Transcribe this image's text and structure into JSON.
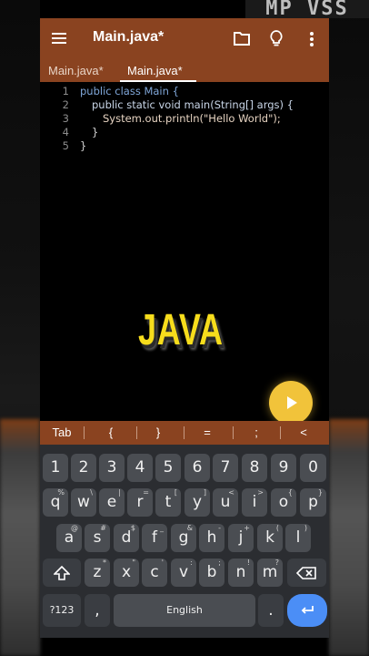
{
  "overlay": {
    "watermark": "MP VSS",
    "paren": ")",
    "caption": "JAVA"
  },
  "app": {
    "title": "Main.java*",
    "icons": [
      "menu-icon",
      "folder-icon",
      "lightbulb-icon",
      "more-vert-icon"
    ],
    "accent": "#8a4320"
  },
  "tabs": [
    {
      "label": "Main.java*",
      "active": false
    },
    {
      "label": "Main.java*",
      "active": true
    }
  ],
  "editor": {
    "lines": [
      {
        "n": "1",
        "text": "public class Main {"
      },
      {
        "n": "2",
        "text": "public static void main(String[] args) {"
      },
      {
        "n": "3",
        "text": "System.out.println(\"Hello World\");"
      },
      {
        "n": "4",
        "text": "}"
      },
      {
        "n": "5",
        "text": "}"
      }
    ]
  },
  "run_button": {
    "icon": "play-icon",
    "color": "#f1c33a"
  },
  "symbols": [
    "Tab",
    "{",
    "}",
    "=",
    ";",
    "<"
  ],
  "keyboard": {
    "row_numbers": [
      "1",
      "2",
      "3",
      "4",
      "5",
      "6",
      "7",
      "8",
      "9",
      "0"
    ],
    "row1": [
      {
        "k": "q",
        "s": "%"
      },
      {
        "k": "w",
        "s": "\\"
      },
      {
        "k": "e",
        "s": "|"
      },
      {
        "k": "r",
        "s": "="
      },
      {
        "k": "t",
        "s": "["
      },
      {
        "k": "y",
        "s": "]"
      },
      {
        "k": "u",
        "s": "<"
      },
      {
        "k": "i",
        "s": ">"
      },
      {
        "k": "o",
        "s": "{"
      },
      {
        "k": "p",
        "s": "}"
      }
    ],
    "row2": [
      {
        "k": "a",
        "s": "@"
      },
      {
        "k": "s",
        "s": "#"
      },
      {
        "k": "d",
        "s": "$"
      },
      {
        "k": "f",
        "s": "_"
      },
      {
        "k": "g",
        "s": "&"
      },
      {
        "k": "h",
        "s": "-"
      },
      {
        "k": "j",
        "s": "+"
      },
      {
        "k": "k",
        "s": "("
      },
      {
        "k": "l",
        "s": ")"
      }
    ],
    "row3": [
      {
        "k": "z",
        "s": "*"
      },
      {
        "k": "x",
        "s": "\""
      },
      {
        "k": "c",
        "s": "'"
      },
      {
        "k": "v",
        "s": ":"
      },
      {
        "k": "b",
        "s": ";"
      },
      {
        "k": "n",
        "s": "!"
      },
      {
        "k": "m",
        "s": "?"
      }
    ],
    "symbols_key": "?123",
    "comma_key": ",",
    "space_label": "English",
    "period_key": ".",
    "shift_icon": "shift-icon",
    "backspace_icon": "backspace-icon",
    "enter_icon": "enter-icon"
  }
}
